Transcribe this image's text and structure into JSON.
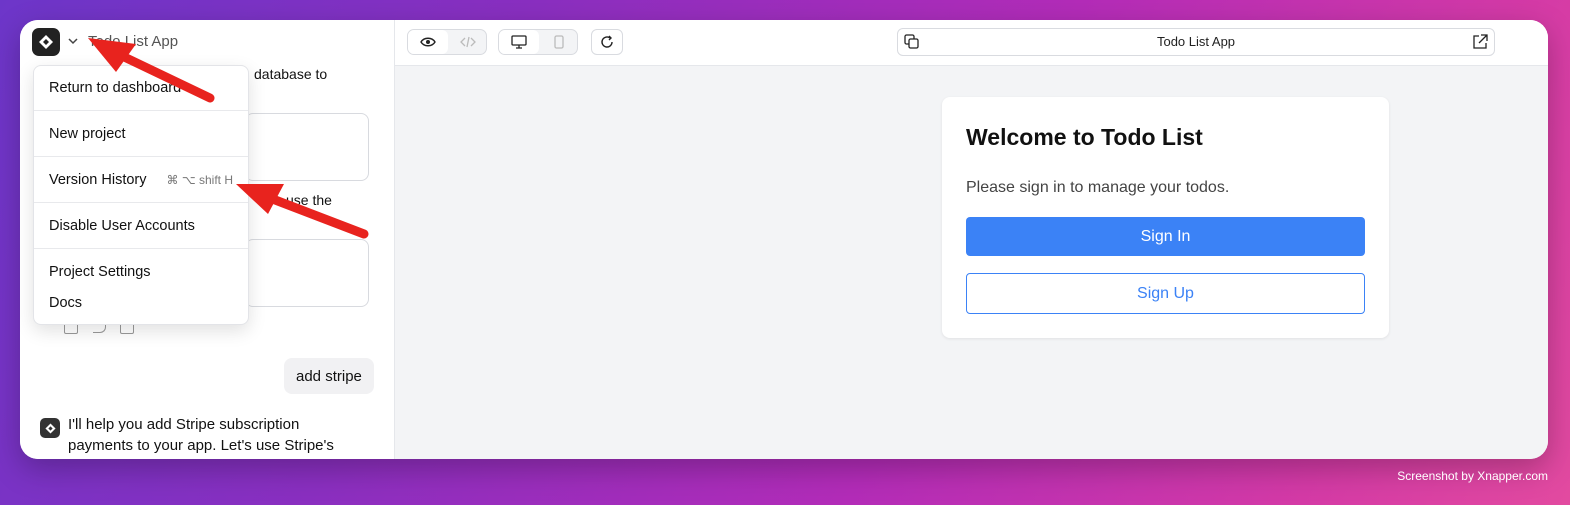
{
  "app": {
    "title": "Todo List App"
  },
  "chat": {
    "partial_text_1": "database to",
    "partial_text_2": "use the",
    "user_message": "add stripe",
    "assistant_message": "I'll help you add Stripe subscription payments to your app. Let's use Stripe's"
  },
  "menu": {
    "items": [
      {
        "label": "Return to dashboard"
      },
      {
        "label": "New project"
      },
      {
        "label": "Version History",
        "shortcut": "⌘ ⌥ shift H"
      },
      {
        "label": "Disable User Accounts"
      },
      {
        "label": "Project Settings"
      },
      {
        "label": "Docs"
      }
    ]
  },
  "preview": {
    "url_title": "Todo List App",
    "welcome_title": "Welcome to Todo List",
    "welcome_subtitle": "Please sign in to manage your todos.",
    "sign_in_label": "Sign In",
    "sign_up_label": "Sign Up"
  },
  "colors": {
    "accent": "#3b82f6",
    "annotation_arrow": "#e8231e"
  },
  "credit": "Screenshot by Xnapper.com"
}
